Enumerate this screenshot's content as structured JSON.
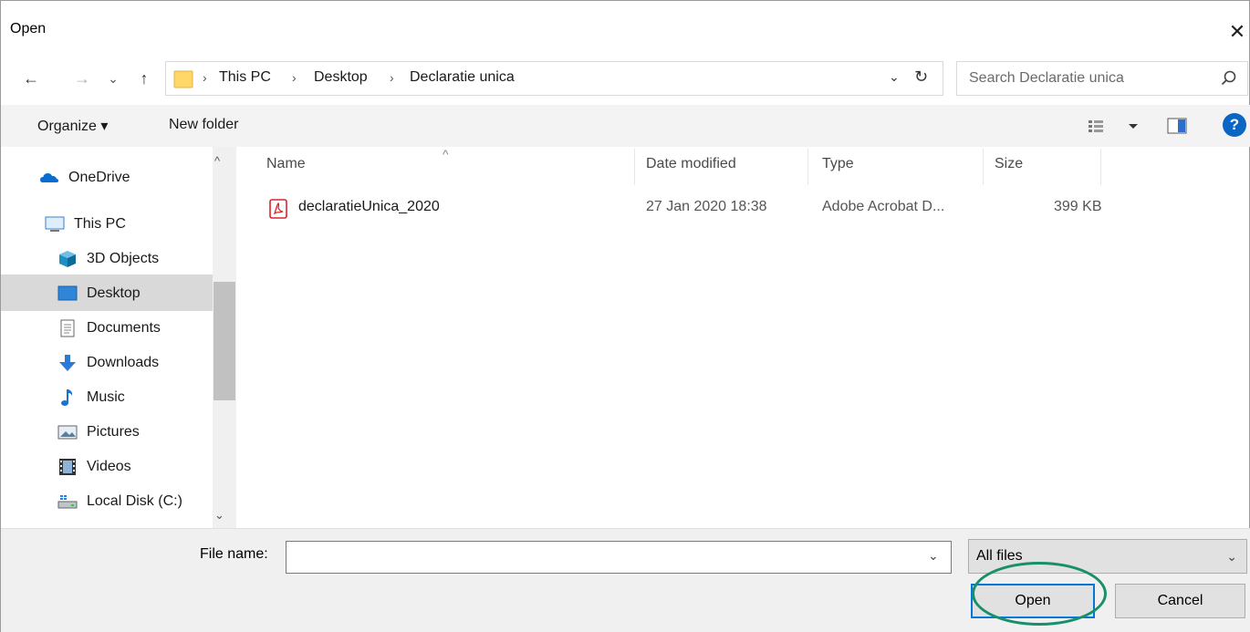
{
  "window": {
    "title": "Open",
    "close_glyph": "✕"
  },
  "nav": {
    "back_glyph": "←",
    "forward_glyph": "→",
    "recent_glyph": "⌄",
    "up_glyph": "↑",
    "breadcrumbs": [
      "This PC",
      "Desktop",
      "Declaratie unica"
    ],
    "breadcrumb_sep": "›",
    "dropdown_glyph": "⌄",
    "refresh_glyph": "↻"
  },
  "search": {
    "placeholder": "Search Declaratie unica"
  },
  "toolbar": {
    "organize": "Organize ▾",
    "new_folder": "New folder",
    "help": "?"
  },
  "sidebar": {
    "items": [
      {
        "label": "OneDrive",
        "icon": "onedrive-cloud-icon"
      },
      {
        "label": "This PC",
        "icon": "monitor-icon"
      },
      {
        "label": "3D Objects",
        "icon": "3d-objects-icon"
      },
      {
        "label": "Desktop",
        "icon": "desktop-icon"
      },
      {
        "label": "Documents",
        "icon": "document-icon"
      },
      {
        "label": "Downloads",
        "icon": "download-arrow-icon"
      },
      {
        "label": "Music",
        "icon": "music-note-icon"
      },
      {
        "label": "Pictures",
        "icon": "picture-icon"
      },
      {
        "label": "Videos",
        "icon": "film-icon"
      },
      {
        "label": "Local Disk (C:)",
        "icon": "drive-icon"
      }
    ],
    "scroll_up": "^",
    "scroll_down": "⌄"
  },
  "filelist": {
    "sort_arrow": "^",
    "columns": [
      "Name",
      "Date modified",
      "Type",
      "Size"
    ],
    "rows": [
      {
        "name": "declaratieUnica_2020",
        "date": "27 Jan 2020 18:38",
        "type": "Adobe Acrobat D...",
        "size": "399 KB"
      }
    ]
  },
  "footer": {
    "file_name_label": "File name:",
    "file_name_value": "",
    "file_name_dropdown": "⌄",
    "file_type": "All files",
    "file_type_arrow": "⌄",
    "open": "Open",
    "cancel": "Cancel"
  },
  "colors": {
    "accent": "#0078d7",
    "highlight": "#17906a",
    "pdf_red": "#d9252a"
  }
}
